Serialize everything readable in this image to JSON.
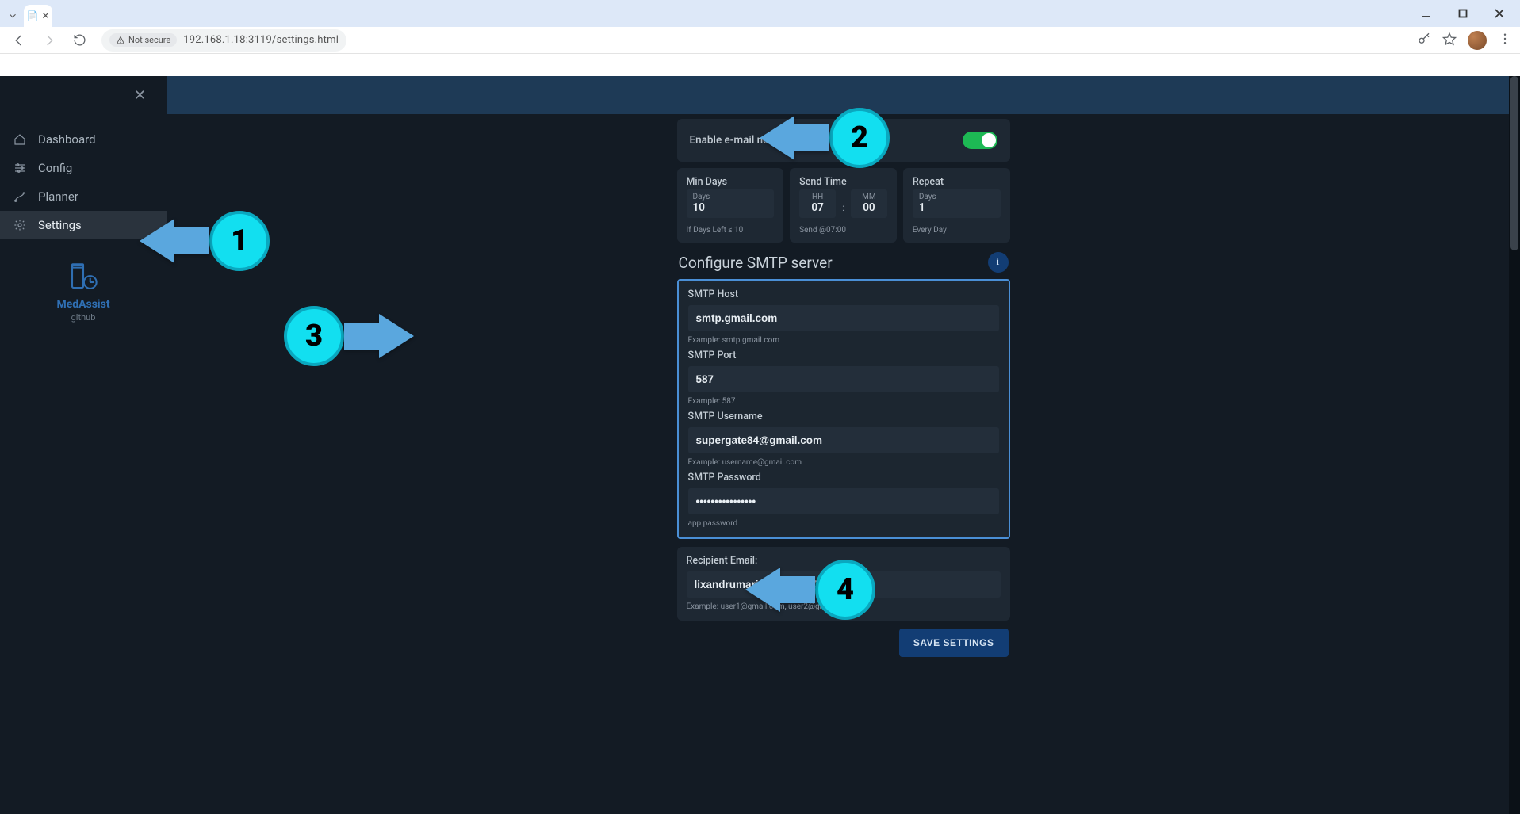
{
  "browser": {
    "url": "192.168.1.18:3119/settings.html",
    "security_label": "Not secure",
    "tab_title": ""
  },
  "sidebar": {
    "items": [
      {
        "label": "Dashboard"
      },
      {
        "label": "Config"
      },
      {
        "label": "Planner"
      },
      {
        "label": "Settings"
      }
    ],
    "brand_name": "MedAssist",
    "brand_sub": "github"
  },
  "settings": {
    "toggle_label": "Enable e-mail notifications",
    "toggle_on": true,
    "min_days": {
      "title": "Min Days",
      "unit": "Days",
      "value": "10",
      "hint": "If Days Left ≤ 10"
    },
    "send_time": {
      "title": "Send Time",
      "hh_label": "HH",
      "hh": "07",
      "mm_label": "MM",
      "mm": "00",
      "hint": "Send @07:00"
    },
    "repeat": {
      "title": "Repeat",
      "unit": "Days",
      "value": "1",
      "hint": "Every Day"
    },
    "section_title": "Configure SMTP server",
    "info_label": "i",
    "smtp": {
      "host": {
        "label": "SMTP Host",
        "value": "smtp.gmail.com",
        "hint": "Example: smtp.gmail.com"
      },
      "port": {
        "label": "SMTP Port",
        "value": "587",
        "hint": "Example: 587"
      },
      "user": {
        "label": "SMTP Username",
        "value": "supergate84@gmail.com",
        "hint": "Example: username@gmail.com"
      },
      "pass": {
        "label": "SMTP Password",
        "value": "••••••••••••••••",
        "hint": "app password"
      }
    },
    "recipient": {
      "label": "Recipient Email:",
      "value": "lixandrumariusbogdan@gmail.com",
      "hint": "Example: user1@gmail.com, user2@gmail.com"
    },
    "save_label": "SAVE SETTINGS"
  },
  "callouts": {
    "n1": "1",
    "n2": "2",
    "n3": "3",
    "n4": "4"
  }
}
